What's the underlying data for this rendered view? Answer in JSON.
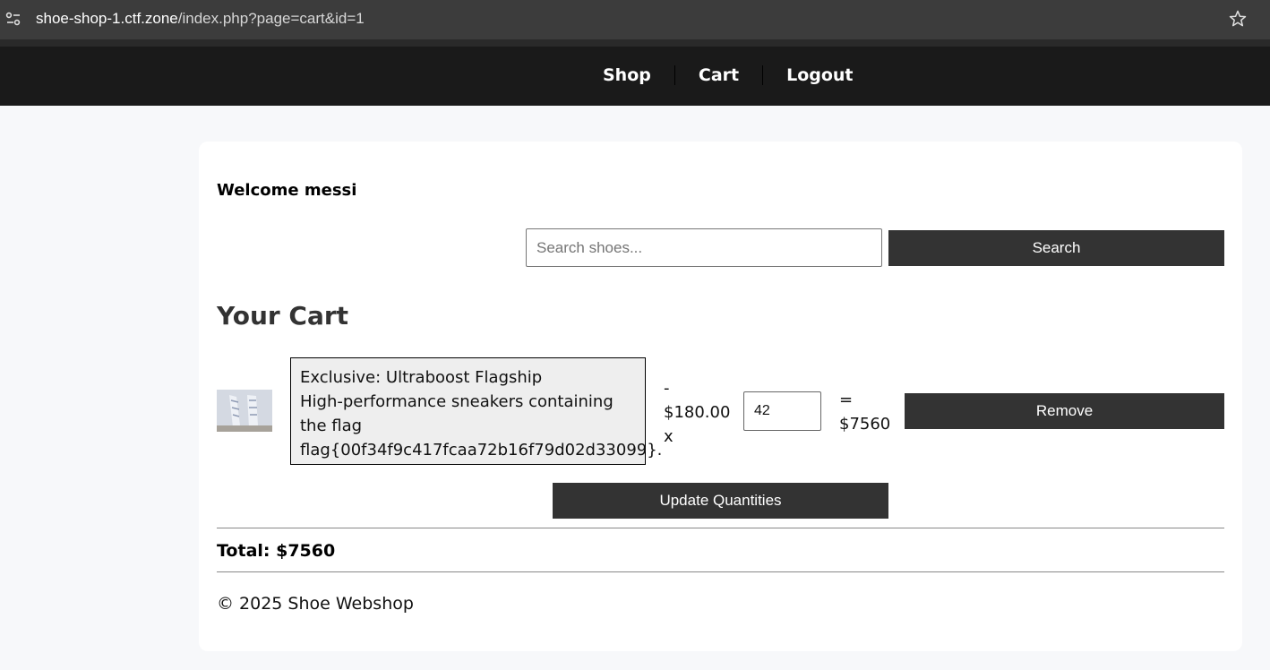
{
  "browser": {
    "url_host": "shoe-shop-1.ctf.zone",
    "url_path": "/index.php?page=cart&id=1"
  },
  "nav": {
    "shop": "Shop",
    "cart": "Cart",
    "logout": "Logout"
  },
  "welcome": "Welcome messi",
  "search": {
    "placeholder": "Search shoes...",
    "button": "Search"
  },
  "cart": {
    "heading": "Your Cart",
    "items": [
      {
        "image": "shoe-thumbnail",
        "description_lines": [
          "Exclusive: Ultraboost Flagship",
          "High-performance sneakers containing",
          "the flag",
          "flag{00f34f9c417fcaa72b16f79d02d33099}."
        ],
        "price_lines": [
          "-",
          "$180.00",
          "x"
        ],
        "quantity": "42",
        "subtotal_lines": [
          "=",
          "$7560"
        ],
        "remove_label": "Remove"
      }
    ],
    "update_label": "Update Quantities",
    "total": "Total: $7560"
  },
  "footer": "© 2025 Shoe Webshop"
}
